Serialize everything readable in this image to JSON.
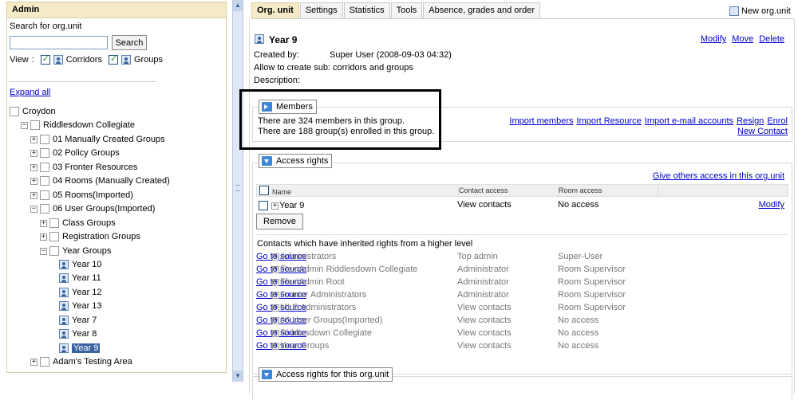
{
  "left_panel": {
    "header": "Admin",
    "search_label": "Search for org.unit",
    "search_value": "",
    "search_button": "Search",
    "view_label": "View",
    "view_colon": ":",
    "corridors_label": "Corridors",
    "groups_label": "Groups",
    "expand_all": "Expand all",
    "tree": [
      {
        "label": "Croydon"
      },
      {
        "label": "Riddlesdown Collegiate",
        "toggle": "−"
      },
      {
        "label": "01 Manually Created Groups",
        "toggle": "+"
      },
      {
        "label": "02 Policy Groups",
        "toggle": "+"
      },
      {
        "label": "03 Fronter Resources",
        "toggle": "+"
      },
      {
        "label": "04 Rooms (Manually Created)",
        "toggle": "+"
      },
      {
        "label": "05 Rooms(Imported)",
        "toggle": "+"
      },
      {
        "label": "06 User Groups(Imported)",
        "toggle": "−"
      },
      {
        "label": "Class Groups",
        "toggle": "+"
      },
      {
        "label": "Registration Groups",
        "toggle": "+"
      },
      {
        "label": "Year Groups",
        "toggle": "−"
      },
      {
        "label": "Year 10"
      },
      {
        "label": "Year 11"
      },
      {
        "label": "Year 12"
      },
      {
        "label": "Year 13"
      },
      {
        "label": "Year 7"
      },
      {
        "label": "Year 8"
      },
      {
        "label": "Year 9",
        "selected": true
      },
      {
        "label": "Adam's Testing Area",
        "toggle": "+"
      }
    ]
  },
  "tabs": [
    "Org. unit",
    "Settings",
    "Statistics",
    "Tools",
    "Absence, grades and order"
  ],
  "new_org_unit": "New org.unit",
  "org_unit": {
    "title": "Year 9",
    "actions": [
      "Modify",
      "Move",
      "Delete"
    ],
    "created_by_label": "Created by:",
    "created_by_value": "Super User (2008-09-03 04:32)",
    "allow_label": "Allow to create sub:",
    "allow_value": "corridors and groups",
    "description_label": "Description:"
  },
  "members": {
    "legend": "Members",
    "line1": "There are 324 members in this group.",
    "line2": "There are 188 group(s) enrolled in this group.",
    "links": [
      "Import members",
      "Import Resource",
      "Import e-mail accounts",
      "Resign",
      "Enrol"
    ],
    "new_contact": "New Contact"
  },
  "access_rights": {
    "legend": "Access rights",
    "give_access": "Give others access in this org.unit",
    "columns": [
      "Name",
      "Contact access",
      "Room access"
    ],
    "row": {
      "toggle": "+",
      "name": "Year 9",
      "contact": "View contacts",
      "room": "No access",
      "action": "Modify"
    },
    "remove_button": "Remove",
    "inherited_title": "Contacts which have inherited rights from a higher level",
    "inherited": [
      {
        "toggle": "+",
        "name": "Administrators",
        "contact": "Top admin",
        "room": "Super-User",
        "link": "Go to source"
      },
      {
        "toggle": "+",
        "name": "FlexiAdmin Riddlesdown Collegiate",
        "contact": "Administrator",
        "room": "Room Supervisor",
        "link": "Go to source"
      },
      {
        "toggle": "+",
        "name": "FlexiAdmin Root",
        "contact": "Administrator",
        "room": "Room Supervisor",
        "link": "Go to source"
      },
      {
        "toggle": "+",
        "name": "Fronter Administrators",
        "contact": "Administrator",
        "room": "Room Supervisor",
        "link": "Go to source"
      },
      {
        "toggle": "+",
        "name": "MLE Administrators",
        "contact": "View contacts",
        "room": "Room Supervisor",
        "link": "Go to source"
      },
      {
        "toggle": "+",
        "name": "06 User Groups(Imported)",
        "contact": "View contacts",
        "room": "No access",
        "link": "Go to source"
      },
      {
        "toggle": "+",
        "name": "Riddlesdown Collegiate",
        "contact": "View contacts",
        "room": "No access",
        "link": "Go to source"
      },
      {
        "toggle": "+",
        "name": "Year Groups",
        "contact": "View contacts",
        "room": "No access",
        "link": "Go to source"
      }
    ]
  },
  "access_rights_org": {
    "legend": "Access rights for this org.unit"
  },
  "colors": {
    "header_bg": "#f5eac7",
    "link": "#0000cc",
    "icon_blue": "#3d87d8",
    "selected_bg": "#3a64a0"
  },
  "scroll_icons": {
    "up": "▲",
    "down": "▼"
  }
}
